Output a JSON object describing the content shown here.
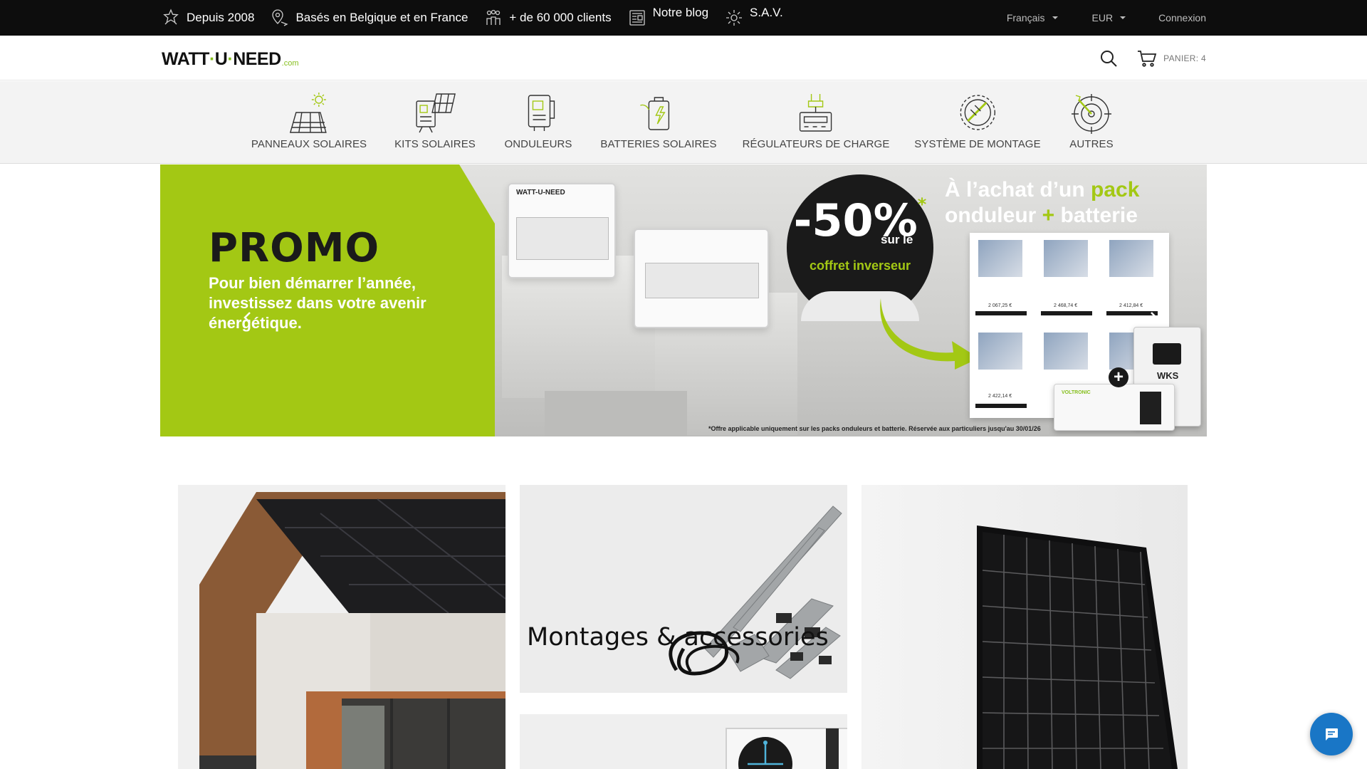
{
  "topbar": {
    "trust": [
      {
        "icon": "star-badge-icon",
        "label": "Depuis 2008"
      },
      {
        "icon": "map-pin-icon",
        "label": "Basés en Belgique et en France"
      },
      {
        "icon": "people-icon",
        "label": "+ de 60 000 clients"
      },
      {
        "icon": "newspaper-icon",
        "label": "Notre blog"
      },
      {
        "icon": "gear-support-icon",
        "label": "S.A.V."
      }
    ],
    "language": "Français",
    "currency": "EUR",
    "login": "Connexion"
  },
  "header": {
    "logo": {
      "part1": "WATT",
      "part2": "U",
      "part3": "NEED",
      "tld": ".com"
    },
    "cart_label": "PANIER: 4"
  },
  "categories": [
    {
      "icon": "solar-panel-icon",
      "label": "PANNEAUX SOLAIRES"
    },
    {
      "icon": "solar-kit-icon",
      "label": "KITS SOLAIRES"
    },
    {
      "icon": "inverter-icon",
      "label": "ONDULEURS"
    },
    {
      "icon": "battery-icon",
      "label": "BATTERIES SOLAIRES"
    },
    {
      "icon": "charge-controller-icon",
      "label": "RÉGULATEURS DE CHARGE"
    },
    {
      "icon": "mounting-system-icon",
      "label": "SYSTÈME DE MONTAGE"
    },
    {
      "icon": "target-icon",
      "label": "AUTRES"
    }
  ],
  "hero": {
    "title": "PROMO",
    "subtitle": "Pour bien démarrer l’année, investissez dans votre avenir énergétique.",
    "discount": "-50%",
    "asterisk": "*",
    "discount_suffix": "sur le",
    "discount_target": "coffret inverseur",
    "pack_line1_a": "À l’achat d’un ",
    "pack_line1_b": "pack",
    "pack_line2_a": "onduleur ",
    "pack_line2_b": "+",
    "pack_line2_c": " batterie",
    "prices": [
      "2 067,25 €",
      "2 468,74 €",
      "2 412,84 €",
      "2 422,14 €"
    ],
    "disclaimer": "*Offre applicable uniquement sur les packs onduleurs et batterie. Réservée aux particuliers jusqu'au 30/01/26",
    "cabinet_brand": "WATT-U-NEED",
    "inverter_brand": "WKS",
    "battery_brand": "VOLTRONIC"
  },
  "cards": {
    "mounting_label": "Montages & accessories"
  },
  "colors": {
    "accent_green": "#a3c814",
    "chat_blue": "#1976c6",
    "topbar": "#0d0d0d"
  }
}
